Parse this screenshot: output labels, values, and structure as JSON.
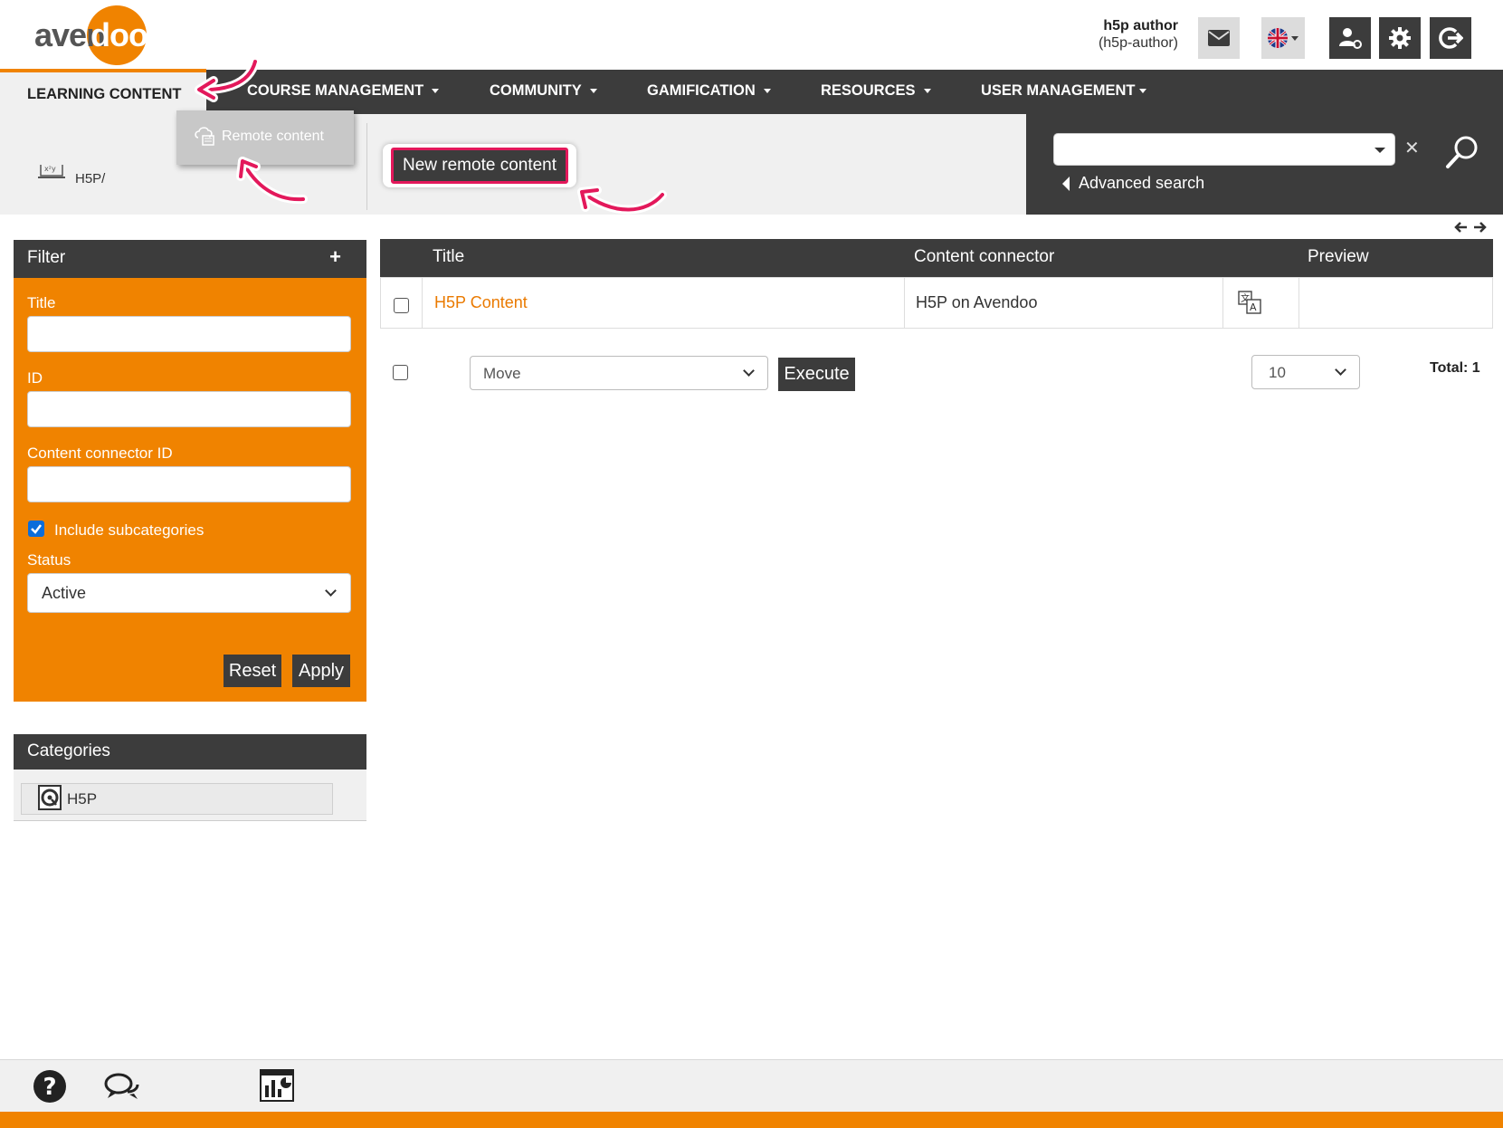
{
  "brand": {
    "logo_left": "aven",
    "logo_right": "doo",
    "accent": "#f08300",
    "dark": "#3c3c3c",
    "highlight": "#e3185b"
  },
  "user": {
    "name": "h5p author",
    "login": "(h5p-author)"
  },
  "header_icons": [
    "mail-icon",
    "uk-flag-icon",
    "user-switch-icon",
    "gear-icon",
    "logout-icon"
  ],
  "nav": {
    "active": "LEARNING CONTENT",
    "items": [
      "COURSE MANAGEMENT",
      "COMMUNITY",
      "GAMIFICATION",
      "RESOURCES",
      "USER MANAGEMENT"
    ],
    "dropdown_item": "Remote content"
  },
  "breadcrumb": {
    "label": "H5P/"
  },
  "toolbar": {
    "new_button": "New remote content"
  },
  "search": {
    "placeholder": "",
    "advanced": "Advanced search"
  },
  "filter": {
    "title": "Filter",
    "plus": "+",
    "title_label": "Title",
    "id_label": "ID",
    "connector_label": "Content connector ID",
    "include_sub_label": "Include subcategories",
    "include_sub_checked": true,
    "status_label": "Status",
    "status_value": "Active",
    "reset": "Reset",
    "apply": "Apply"
  },
  "categories": {
    "title": "Categories",
    "items": [
      {
        "label": "H5P"
      }
    ]
  },
  "table": {
    "columns": [
      "Title",
      "Content connector",
      "Preview"
    ],
    "rows": [
      {
        "title": "H5P Content",
        "connector": "H5P on Avendoo"
      }
    ],
    "bulk_action": "Move",
    "execute": "Execute",
    "per_page": "10",
    "total": "Total: 1"
  },
  "footer_icons": [
    "help-icon",
    "chat-icon",
    "report-icon"
  ]
}
